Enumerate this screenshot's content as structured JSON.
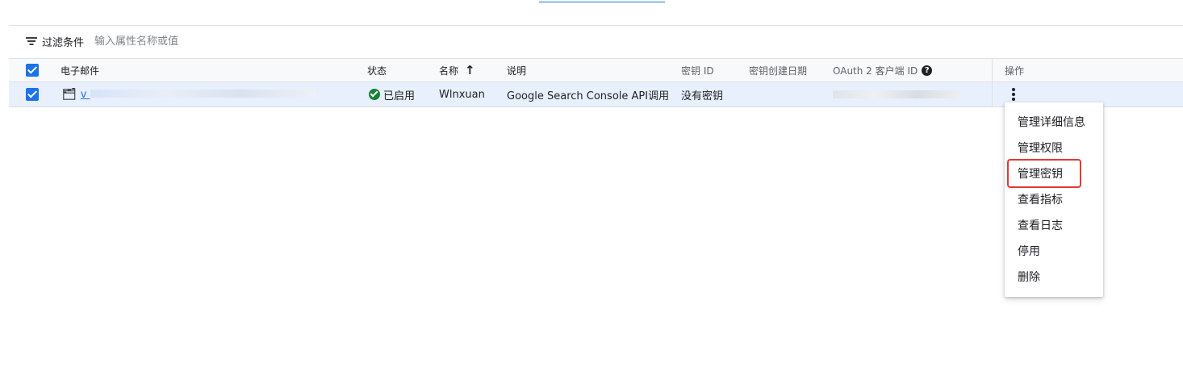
{
  "filter": {
    "label": "过滤条件",
    "placeholder": "输入属性名称或值"
  },
  "table": {
    "headers": {
      "email": "电子邮件",
      "status": "状态",
      "name": "名称",
      "description": "说明",
      "key_id": "密钥 ID",
      "key_created": "密钥创建日期",
      "oauth_client_id": "OAuth 2 客户端 ID",
      "actions": "操作"
    },
    "sort": {
      "column": "name",
      "direction": "ascending"
    },
    "rows": [
      {
        "selected": true,
        "email_prefix": "v",
        "status": "已启用",
        "name": "Wlnxuan",
        "description": "Google Search Console API调用",
        "key_id": "没有密钥",
        "key_created": ""
      }
    ]
  },
  "menu": {
    "items": [
      {
        "label": "管理详细信息"
      },
      {
        "label": "管理权限"
      },
      {
        "label": "管理密钥",
        "highlighted": true
      },
      {
        "label": "查看指标"
      },
      {
        "label": "查看日志"
      },
      {
        "label": "停用"
      },
      {
        "label": "删除"
      }
    ]
  },
  "colors": {
    "accent": "#1a73e8",
    "status_ok": "#188038",
    "row_selected": "#e8f0fe",
    "highlight": "#e53935"
  }
}
